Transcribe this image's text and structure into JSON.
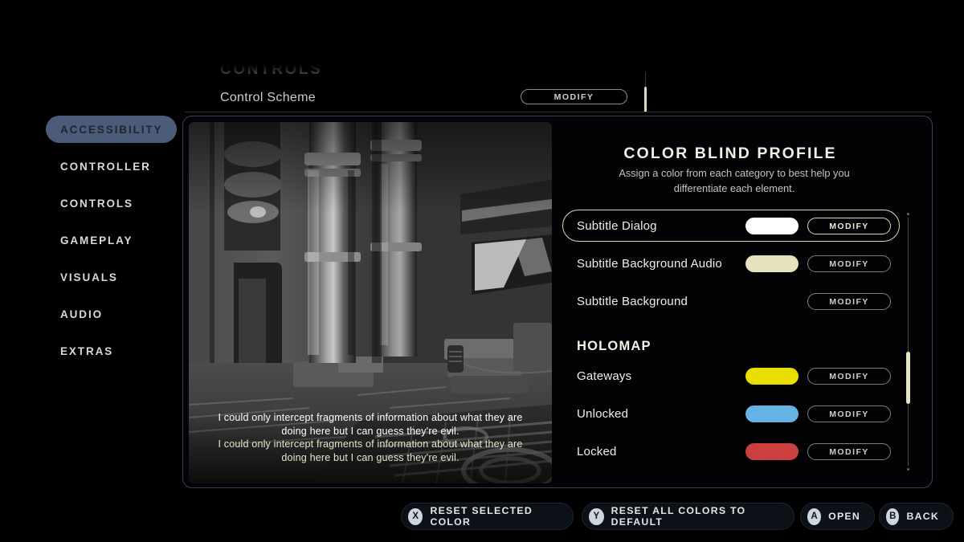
{
  "background_screen": {
    "section_heading": "CONTROLS",
    "row_label": "Control Scheme",
    "row_button": "MODIFY"
  },
  "sidebar": {
    "items": [
      {
        "label": "ACCESSIBILITY",
        "selected": true
      },
      {
        "label": "CONTROLLER",
        "selected": false
      },
      {
        "label": "CONTROLS",
        "selected": false
      },
      {
        "label": "GAMEPLAY",
        "selected": false
      },
      {
        "label": "VISUALS",
        "selected": false
      },
      {
        "label": "AUDIO",
        "selected": false
      },
      {
        "label": "EXTRAS",
        "selected": false
      }
    ]
  },
  "preview": {
    "subtitle_primary": "I could only intercept fragments of information about what they are doing here but I can guess they're evil.",
    "subtitle_secondary": "I could only intercept fragments of information about what they are doing here but I can guess they're evil.",
    "subtitle_primary_color": "#ffffff",
    "subtitle_secondary_color": "#e8e5c8"
  },
  "options": {
    "title": "COLOR BLIND PROFILE",
    "description": "Assign a color from each category to best help you differentiate each element.",
    "modify_label": "MODIFY",
    "rows": [
      {
        "label": "Subtitle Dialog",
        "color": "#ffffff",
        "has_swatch": true,
        "selected": true
      },
      {
        "label": "Subtitle Background Audio",
        "color": "#e5e2bd",
        "has_swatch": true,
        "selected": false
      },
      {
        "label": "Subtitle Background",
        "color": "",
        "has_swatch": false,
        "selected": false
      }
    ],
    "group_heading": "HOLOMAP",
    "group_rows": [
      {
        "label": "Gateways",
        "color": "#e8de00",
        "has_swatch": true,
        "selected": false
      },
      {
        "label": "Unlocked",
        "color": "#63b4e5",
        "has_swatch": true,
        "selected": false
      },
      {
        "label": "Locked",
        "color": "#cc3f3f",
        "has_swatch": true,
        "selected": false
      }
    ],
    "scrollbar": {
      "thumb_position_percent": 54
    }
  },
  "button_bar": [
    {
      "button": "X",
      "label": "RESET SELECTED COLOR"
    },
    {
      "button": "Y",
      "label": "RESET ALL COLORS TO DEFAULT"
    },
    {
      "button": "A",
      "label": "OPEN"
    },
    {
      "button": "B",
      "label": "BACK"
    }
  ],
  "theme": {
    "accent_cream": "#ddd9b8",
    "sidebar_selected_bg": "#4a5c78",
    "panel_border": "#3a4357",
    "background": "#000000"
  }
}
